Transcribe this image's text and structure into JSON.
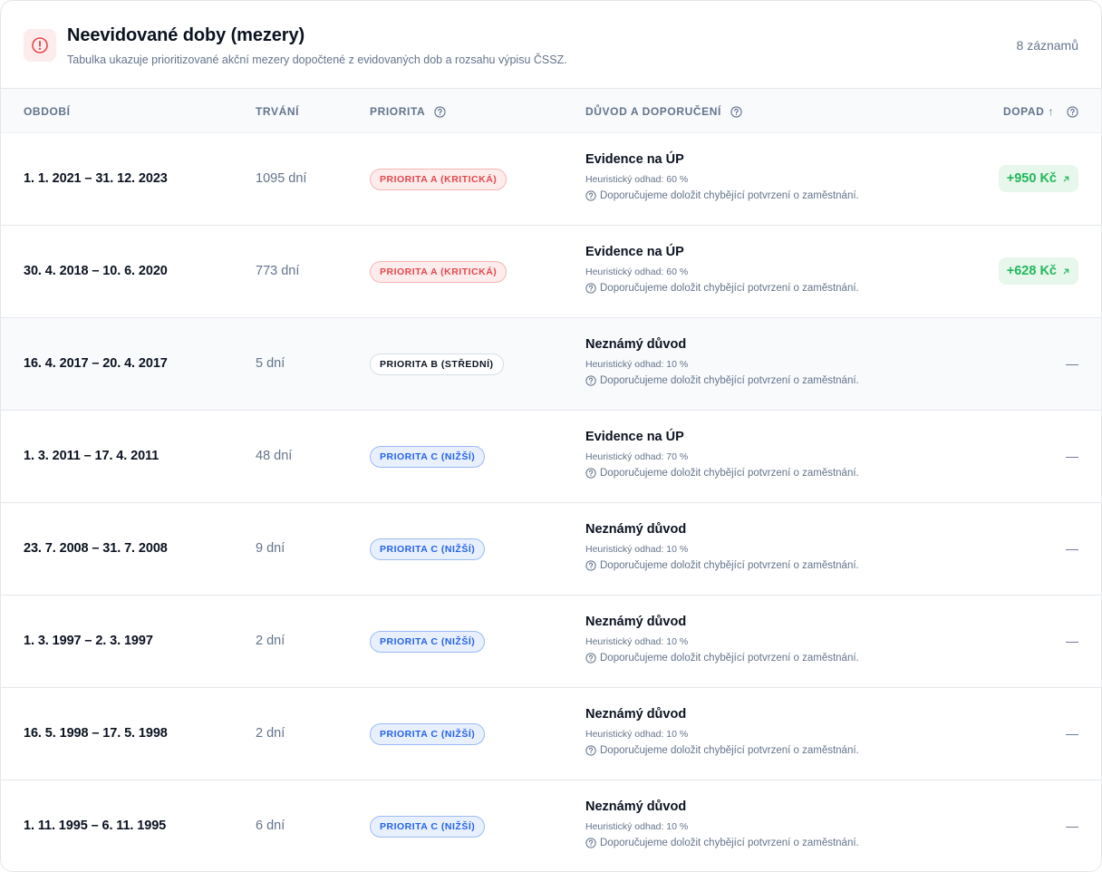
{
  "header": {
    "title": "Neevidované doby (mezery)",
    "subtitle": "Tabulka ukazuje prioritizované akční mezery dopočtené z evidovaných dob a rozsahu výpisu ČSSZ.",
    "count": "8 záznamů"
  },
  "columns": {
    "period": "Období",
    "duration": "Trvání",
    "priority": "Priorita",
    "reason": "Důvod a doporučení",
    "impact": "Dopad",
    "impact_sort": "↑"
  },
  "rows": [
    {
      "period": "1. 1. 2021 – 31. 12. 2023",
      "duration": "1095 dní",
      "priority": "Priorita A (kritická)",
      "priority_level": "a",
      "reason": "Evidence na ÚP",
      "estimate": "Heuristický odhad: 60 %",
      "recommendation": "Doporučujeme doložit chybějící potvrzení o zaměstnání.",
      "impact": "+950 Kč"
    },
    {
      "period": "30. 4. 2018 – 10. 6. 2020",
      "duration": "773 dní",
      "priority": "Priorita A (kritická)",
      "priority_level": "a",
      "reason": "Evidence na ÚP",
      "estimate": "Heuristický odhad: 60 %",
      "recommendation": "Doporučujeme doložit chybějící potvrzení o zaměstnání.",
      "impact": "+628 Kč"
    },
    {
      "period": "16. 4. 2017 – 20. 4. 2017",
      "duration": "5 dní",
      "priority": "Priorita B (střední)",
      "priority_level": "b",
      "reason": "Neznámý důvod",
      "estimate": "Heuristický odhad: 10 %",
      "recommendation": "Doporučujeme doložit chybějící potvrzení o zaměstnání.",
      "impact": "—"
    },
    {
      "period": "1. 3. 2011 – 17. 4. 2011",
      "duration": "48 dní",
      "priority": "Priorita C (nižší)",
      "priority_level": "c",
      "reason": "Evidence na ÚP",
      "estimate": "Heuristický odhad: 70 %",
      "recommendation": "Doporučujeme doložit chybějící potvrzení o zaměstnání.",
      "impact": "—"
    },
    {
      "period": "23. 7. 2008 – 31. 7. 2008",
      "duration": "9 dní",
      "priority": "Priorita C (nižší)",
      "priority_level": "c",
      "reason": "Neznámý důvod",
      "estimate": "Heuristický odhad: 10 %",
      "recommendation": "Doporučujeme doložit chybějící potvrzení o zaměstnání.",
      "impact": "—"
    },
    {
      "period": "1. 3. 1997 – 2. 3. 1997",
      "duration": "2 dní",
      "priority": "Priorita C (nižší)",
      "priority_level": "c",
      "reason": "Neznámý důvod",
      "estimate": "Heuristický odhad: 10 %",
      "recommendation": "Doporučujeme doložit chybějící potvrzení o zaměstnání.",
      "impact": "—"
    },
    {
      "period": "16. 5. 1998 – 17. 5. 1998",
      "duration": "2 dní",
      "priority": "Priorita C (nižší)",
      "priority_level": "c",
      "reason": "Neznámý důvod",
      "estimate": "Heuristický odhad: 10 %",
      "recommendation": "Doporučujeme doložit chybějící potvrzení o zaměstnání.",
      "impact": "—"
    },
    {
      "period": "1. 11. 1995 – 6. 11. 1995",
      "duration": "6 dní",
      "priority": "Priorita C (nižší)",
      "priority_level": "c",
      "reason": "Neznámý důvod",
      "estimate": "Heuristický odhad: 10 %",
      "recommendation": "Doporučujeme doložit chybějící potvrzení o zaměstnání.",
      "impact": "—"
    }
  ],
  "colors": {
    "priority_a": "#e5484d",
    "priority_b": "#0b1220",
    "priority_c": "#2563eb",
    "impact_positive": "#22b85c"
  }
}
